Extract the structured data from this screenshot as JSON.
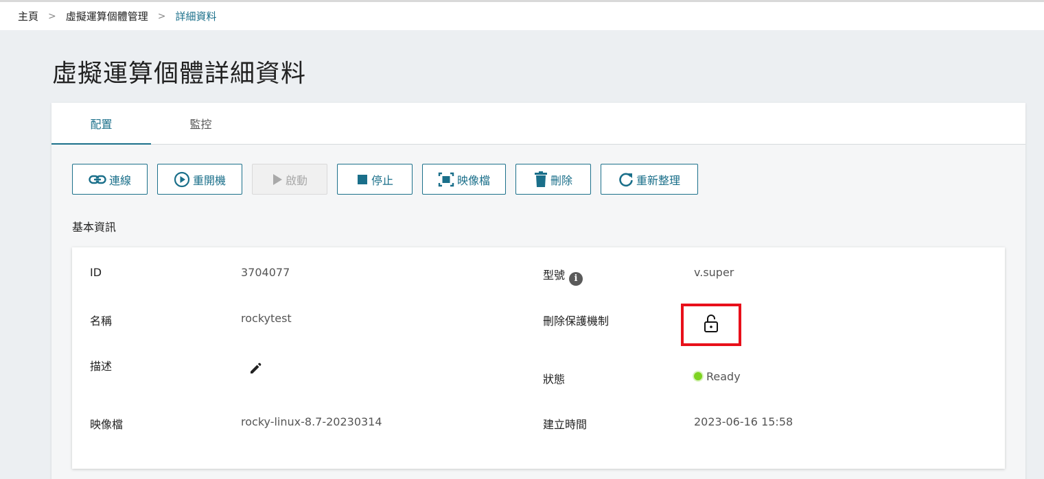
{
  "breadcrumb": {
    "items": [
      "主頁",
      "虛擬運算個體管理",
      "詳細資料"
    ],
    "separator": ">"
  },
  "page": {
    "title": "虛擬運算個體詳細資料"
  },
  "tabs": [
    {
      "label": "配置",
      "active": true
    },
    {
      "label": "監控",
      "active": false
    }
  ],
  "toolbar": {
    "connect_label": "連線",
    "reboot_label": "重開機",
    "start_label": "啟動",
    "stop_label": "停止",
    "image_label": "映像檔",
    "delete_label": "刪除",
    "refresh_label": "重新整理"
  },
  "section": {
    "basic_info_label": "基本資訊"
  },
  "info": {
    "id_label": "ID",
    "id_value": "3704077",
    "name_label": "名稱",
    "name_value": "rockytest",
    "desc_label": "描述",
    "image_label": "映像檔",
    "image_value": "rocky-linux-8.7-20230314",
    "model_label": "型號",
    "model_value": "v.super",
    "protection_label": "刪除保護機制",
    "status_label": "狀態",
    "status_value": "Ready",
    "created_label": "建立時間",
    "created_value": "2023-06-16 15:58"
  },
  "colors": {
    "accent": "#1a6f8a",
    "status_ready": "#7ed321",
    "highlight_box": "#e8101a"
  },
  "icons": {
    "connect": "link-icon",
    "reboot": "play-circle-icon",
    "start": "play-icon",
    "stop": "stop-icon",
    "image": "image-frame-icon",
    "delete": "trash-icon",
    "refresh": "refresh-icon",
    "model_info": "info-icon",
    "protection": "unlock-icon",
    "desc_edit": "pencil-icon"
  }
}
